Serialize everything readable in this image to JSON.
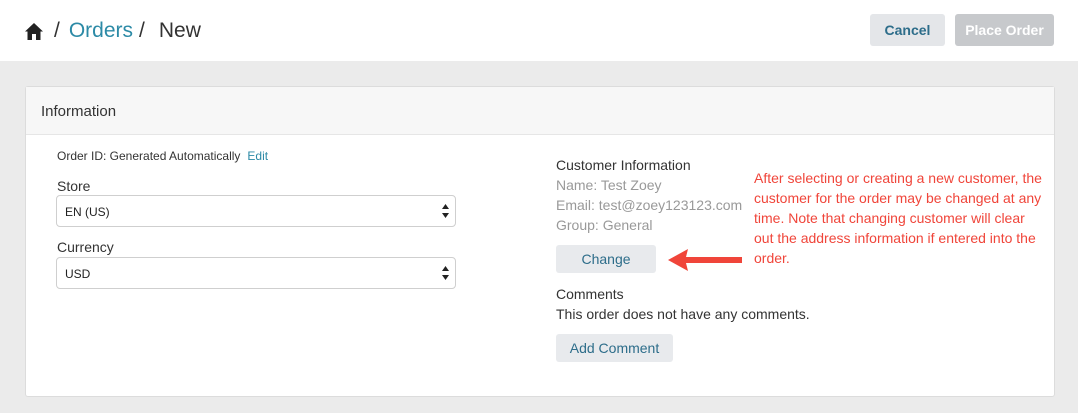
{
  "breadcrumb": {
    "home_icon": "home-icon",
    "separator": "/",
    "orders_label": "Orders",
    "current_label": "New"
  },
  "header_actions": {
    "cancel_label": "Cancel",
    "place_order_label": "Place Order"
  },
  "panel": {
    "title": "Information"
  },
  "order": {
    "id_text": "Order ID: Generated Automatically",
    "edit_label": "Edit"
  },
  "store": {
    "label": "Store",
    "selected": "EN (US)"
  },
  "currency": {
    "label": "Currency",
    "selected": "USD"
  },
  "customer": {
    "title": "Customer Information",
    "name": "Name: Test Zoey",
    "email": "Email: test@zoey123123.com",
    "group": "Group: General",
    "change_label": "Change"
  },
  "comments": {
    "title": "Comments",
    "text": "This order does not have any comments.",
    "add_label": "Add Comment"
  },
  "annotation": {
    "text": "After selecting or creating a new customer, the customer for the order may be changed at any time. Note that changing customer will clear out the address information if entered into the order.",
    "color": "#f0453a"
  },
  "colors": {
    "link": "#2c8aa6",
    "button_text": "#2d6d8a",
    "page_bg": "#ebebeb"
  }
}
